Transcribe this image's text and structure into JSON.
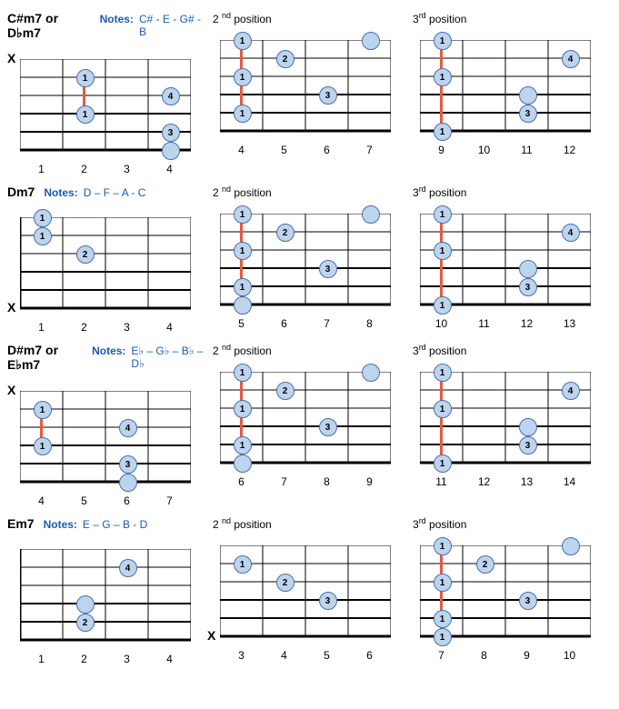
{
  "chart_data": {
    "type": "table",
    "description": "Guitar chord diagrams, 4 chord rows × 3 positions",
    "chords": [
      {
        "name": "C#m7 or D♭m7",
        "notes_label": "Notes:",
        "notes": "C# - E - G# - B",
        "positions": [
          {
            "label": null,
            "frets_start": 1,
            "nut": false,
            "mutes": [
              1
            ],
            "barre": {
              "fret": 2,
              "from": 2,
              "to": 4
            },
            "dots": [
              {
                "string": 2,
                "fret": 2,
                "n": "1"
              },
              {
                "string": 4,
                "fret": 2,
                "n": "1"
              },
              {
                "string": 3,
                "fret": 4,
                "n": "4"
              },
              {
                "string": 5,
                "fret": 4,
                "n": "3"
              },
              {
                "string": 6,
                "fret": 4,
                "n": "",
                "open": true
              }
            ]
          },
          {
            "label": "2 <sup>nd</sup> position",
            "frets_start": 4,
            "nut": false,
            "mutes": [],
            "barre": {
              "fret": 4,
              "from": 1,
              "to": 5
            },
            "dots": [
              {
                "string": 1,
                "fret": 4,
                "n": "1"
              },
              {
                "string": 2,
                "fret": 5,
                "n": "2"
              },
              {
                "string": 3,
                "fret": 4,
                "n": "1"
              },
              {
                "string": 4,
                "fret": 6,
                "n": "3"
              },
              {
                "string": 5,
                "fret": 4,
                "n": "1"
              },
              {
                "string": 1,
                "fret": 7,
                "n": "",
                "open": true
              }
            ]
          },
          {
            "label": "3<sup>rd</sup> position",
            "frets_start": 9,
            "nut": false,
            "mutes": [],
            "barre": {
              "fret": 9,
              "from": 1,
              "to": 6
            },
            "dots": [
              {
                "string": 1,
                "fret": 9,
                "n": "1"
              },
              {
                "string": 2,
                "fret": 12,
                "n": "4"
              },
              {
                "string": 3,
                "fret": 9,
                "n": "1"
              },
              {
                "string": 4,
                "fret": 11,
                "n": "",
                "open": true
              },
              {
                "string": 5,
                "fret": 11,
                "n": "3"
              },
              {
                "string": 6,
                "fret": 9,
                "n": "1"
              }
            ]
          }
        ]
      },
      {
        "name": "Dm7",
        "notes_label": "Notes:",
        "notes": "D – F – A - C",
        "positions": [
          {
            "label": null,
            "frets_start": 1,
            "nut": true,
            "mutes": [
              6
            ],
            "barre": {
              "fret": 1,
              "from": 1,
              "to": 2
            },
            "dots": [
              {
                "string": 1,
                "fret": 1,
                "n": "1"
              },
              {
                "string": 2,
                "fret": 1,
                "n": "1"
              },
              {
                "string": 3,
                "fret": 2,
                "n": "2"
              }
            ]
          },
          {
            "label": "2 <sup>nd</sup> position",
            "frets_start": 5,
            "nut": false,
            "mutes": [],
            "barre": {
              "fret": 5,
              "from": 1,
              "to": 6
            },
            "dots": [
              {
                "string": 1,
                "fret": 5,
                "n": "1"
              },
              {
                "string": 2,
                "fret": 6,
                "n": "2"
              },
              {
                "string": 3,
                "fret": 5,
                "n": "1"
              },
              {
                "string": 4,
                "fret": 7,
                "n": "3"
              },
              {
                "string": 5,
                "fret": 5,
                "n": "1"
              },
              {
                "string": 6,
                "fret": 5,
                "n": "",
                "open": true
              },
              {
                "string": 1,
                "fret": 8,
                "n": "",
                "open": true
              }
            ]
          },
          {
            "label": "3<sup>rd</sup> position",
            "frets_start": 10,
            "nut": false,
            "mutes": [],
            "barre": {
              "fret": 10,
              "from": 1,
              "to": 6
            },
            "dots": [
              {
                "string": 1,
                "fret": 10,
                "n": "1"
              },
              {
                "string": 2,
                "fret": 13,
                "n": "4"
              },
              {
                "string": 3,
                "fret": 10,
                "n": "1"
              },
              {
                "string": 4,
                "fret": 12,
                "n": "",
                "open": true
              },
              {
                "string": 5,
                "fret": 12,
                "n": "3"
              },
              {
                "string": 6,
                "fret": 10,
                "n": "1"
              }
            ]
          }
        ]
      },
      {
        "name": "D#m7 or E♭m7",
        "notes_label": "Notes:",
        "notes": "E♭ – G♭ – B♭ – D♭",
        "positions": [
          {
            "label": null,
            "frets_start": 4,
            "nut": false,
            "mutes": [
              1
            ],
            "barre": {
              "fret": 4,
              "from": 2,
              "to": 4
            },
            "dots": [
              {
                "string": 2,
                "fret": 4,
                "n": "1"
              },
              {
                "string": 3,
                "fret": 6,
                "n": "4"
              },
              {
                "string": 4,
                "fret": 4,
                "n": "1"
              },
              {
                "string": 5,
                "fret": 6,
                "n": "3"
              },
              {
                "string": 6,
                "fret": 6,
                "n": "",
                "open": true
              }
            ]
          },
          {
            "label": "2 <sup>nd</sup> position",
            "frets_start": 6,
            "nut": false,
            "mutes": [],
            "barre": {
              "fret": 6,
              "from": 1,
              "to": 6
            },
            "dots": [
              {
                "string": 1,
                "fret": 6,
                "n": "1"
              },
              {
                "string": 2,
                "fret": 7,
                "n": "2"
              },
              {
                "string": 3,
                "fret": 6,
                "n": "1"
              },
              {
                "string": 4,
                "fret": 8,
                "n": "3"
              },
              {
                "string": 5,
                "fret": 6,
                "n": "1"
              },
              {
                "string": 6,
                "fret": 6,
                "n": "",
                "open": true
              },
              {
                "string": 1,
                "fret": 9,
                "n": "",
                "open": true
              }
            ]
          },
          {
            "label": "3<sup>rd</sup> position",
            "frets_start": 11,
            "nut": false,
            "mutes": [],
            "barre": {
              "fret": 11,
              "from": 1,
              "to": 6
            },
            "dots": [
              {
                "string": 1,
                "fret": 11,
                "n": "1"
              },
              {
                "string": 2,
                "fret": 14,
                "n": "4"
              },
              {
                "string": 3,
                "fret": 11,
                "n": "1"
              },
              {
                "string": 4,
                "fret": 13,
                "n": "",
                "open": true
              },
              {
                "string": 5,
                "fret": 13,
                "n": "3"
              },
              {
                "string": 6,
                "fret": 11,
                "n": "1"
              }
            ]
          }
        ]
      },
      {
        "name": "Em7",
        "notes_label": "Notes:",
        "notes": "E – G – B - D",
        "positions": [
          {
            "label": null,
            "frets_start": 1,
            "nut": true,
            "mutes": [],
            "barre": null,
            "dots": [
              {
                "string": 2,
                "fret": 3,
                "n": "4"
              },
              {
                "string": 4,
                "fret": 2,
                "n": "",
                "open": true
              },
              {
                "string": 5,
                "fret": 2,
                "n": "2"
              }
            ]
          },
          {
            "label": "2 <sup>nd</sup> position",
            "frets_start": 3,
            "nut": false,
            "mutes": [
              6
            ],
            "barre": null,
            "dots": [
              {
                "string": 2,
                "fret": 3,
                "n": "1"
              },
              {
                "string": 3,
                "fret": 4,
                "n": "2"
              },
              {
                "string": 4,
                "fret": 5,
                "n": "3"
              }
            ]
          },
          {
            "label": "3<sup>rd</sup> position",
            "frets_start": 7,
            "nut": false,
            "mutes": [],
            "barre": {
              "fret": 7,
              "from": 1,
              "to": 6
            },
            "dots": [
              {
                "string": 1,
                "fret": 7,
                "n": "1"
              },
              {
                "string": 2,
                "fret": 8,
                "n": "2"
              },
              {
                "string": 3,
                "fret": 7,
                "n": "1"
              },
              {
                "string": 4,
                "fret": 9,
                "n": "3"
              },
              {
                "string": 5,
                "fret": 7,
                "n": "1"
              },
              {
                "string": 6,
                "fret": 7,
                "n": "1"
              },
              {
                "string": 1,
                "fret": 10,
                "n": "",
                "open": true
              }
            ]
          }
        ]
      }
    ]
  }
}
